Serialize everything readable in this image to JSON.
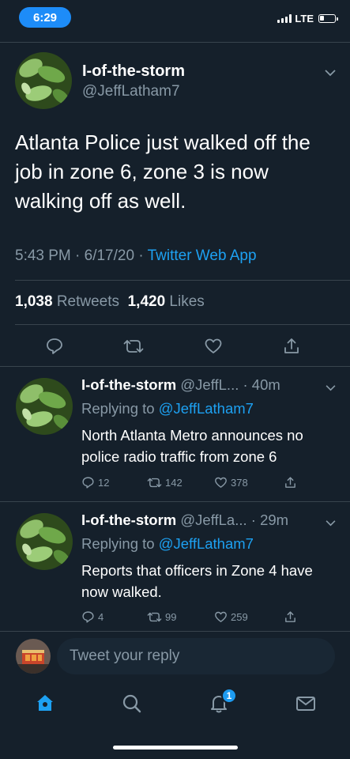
{
  "status_bar": {
    "time": "6:29",
    "network": "LTE"
  },
  "main_tweet": {
    "display_name": "I-of-the-storm",
    "handle": "@JeffLatham7",
    "text": "Atlanta Police just walked off the job in zone 6, zone 3 is now walking off as well.",
    "timestamp": "5:43 PM · 6/17/20 · ",
    "source": "Twitter Web App",
    "retweets_count": "1,038",
    "retweets_label": " Retweets",
    "likes_count": "1,420",
    "likes_label": " Likes"
  },
  "replies": [
    {
      "display_name": "I-of-the-storm",
      "handle_time": " @JeffL... · 40m",
      "replying_prefix": "Replying to ",
      "replying_to": "@JeffLatham7",
      "text": "North Atlanta Metro announces no police radio traffic from zone 6",
      "reply_count": "12",
      "retweet_count": "142",
      "like_count": "378"
    },
    {
      "display_name": "I-of-the-storm",
      "handle_time": " @JeffLa... · 29m",
      "replying_prefix": "Replying to ",
      "replying_to": "@JeffLatham7",
      "text": "Reports that officers in Zone 4 have now walked.",
      "reply_count": "4",
      "retweet_count": "99",
      "like_count": "259"
    }
  ],
  "compose": {
    "placeholder": "Tweet your reply"
  },
  "tabbar": {
    "notifications_badge": "1"
  },
  "colors": {
    "background": "#15202b",
    "accent": "#1da1f2",
    "muted": "#8899a6",
    "divider": "#38444d"
  },
  "icons": [
    "chevron-down-icon",
    "reply-icon",
    "retweet-icon",
    "like-icon",
    "share-icon",
    "home-icon",
    "search-icon",
    "notifications-icon",
    "messages-icon"
  ]
}
